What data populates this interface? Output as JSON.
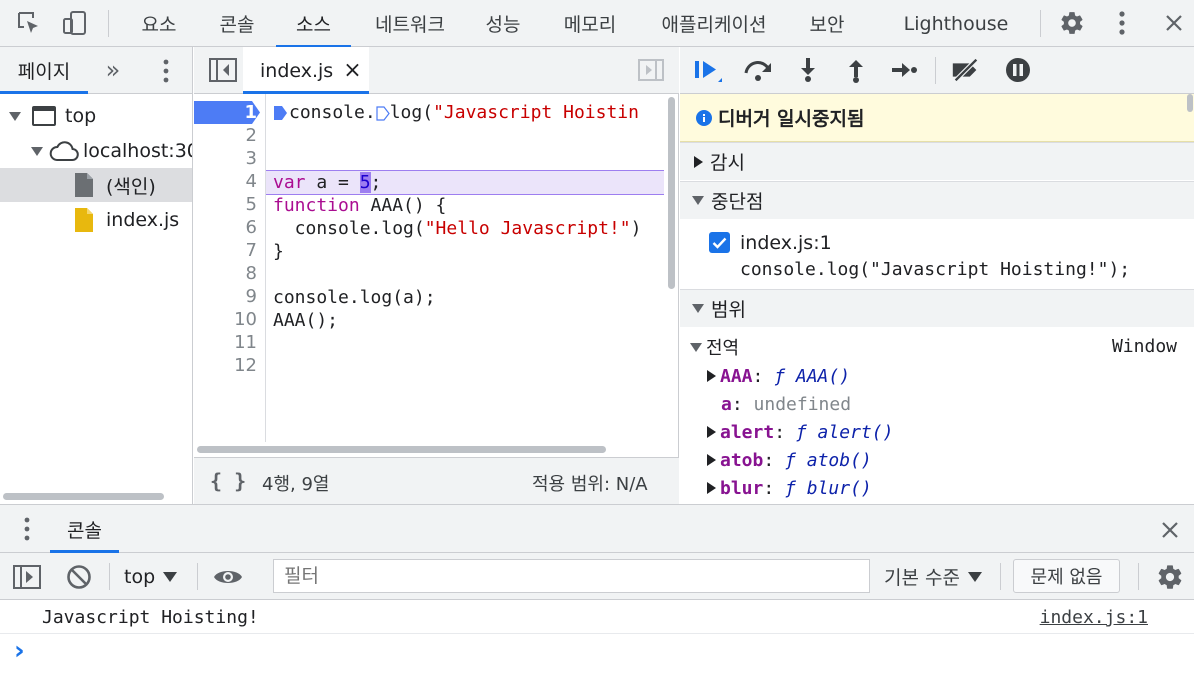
{
  "tabs": [
    "요소",
    "콘솔",
    "소스",
    "네트워크",
    "성능",
    "메모리",
    "애플리케이션",
    "보안",
    "Lighthouse"
  ],
  "active_tab": "소스",
  "navigator": {
    "tab_label": "페이지",
    "more": "»",
    "tree": {
      "top": "top",
      "host": "localhost:30",
      "index_file": "(색인)",
      "js_file": "index.js"
    }
  },
  "editor": {
    "file_tab": "index.js",
    "close_glyph": "×",
    "line_numbers": [
      "1",
      "2",
      "3",
      "4",
      "5",
      "6",
      "7",
      "8",
      "9",
      "10",
      "11",
      "12"
    ],
    "lines": {
      "l1_a": "console.",
      "l1_b": "log(",
      "l1_str": "\"Javascript Hoistin",
      "l4_kw": "var",
      "l4_mid": " a = ",
      "l4_num": "5",
      "l4_end": ";",
      "l5_kw": "function",
      "l5_rest": " AAA() {",
      "l6_a": "  console.log(",
      "l6_str": "\"Hello Javascript!\"",
      "l6_end": ")",
      "l7": "}",
      "l9": "console.log(a);",
      "l10": "AAA();"
    },
    "status": {
      "braces": "{ }",
      "position": "4행, 9열",
      "coverage": "적용 범위: N/A"
    }
  },
  "debugger": {
    "paused_banner": "디버거 일시중지됨",
    "watch_label": "감시",
    "breakpoints_label": "중단점",
    "breakpoint": {
      "location": "index.js:1",
      "code": "console.log(\"Javascript Hoisting!\");",
      "checked": true
    },
    "scope_label": "범위",
    "global_label": "전역",
    "global_value": "Window",
    "scope_items": [
      {
        "name": "AAA",
        "sep": ": ",
        "f": "ƒ",
        "value": " AAA()"
      },
      {
        "name": "a",
        "sep": ": ",
        "value": "undefined"
      },
      {
        "name": "alert",
        "sep": ": ",
        "f": "ƒ",
        "value": " alert()"
      },
      {
        "name": "atob",
        "sep": ": ",
        "f": "ƒ",
        "value": " atob()"
      },
      {
        "name": "blur",
        "sep": ": ",
        "f": "ƒ",
        "value": " blur()"
      }
    ]
  },
  "console": {
    "drawer_tab": "콘솔",
    "context": "top",
    "filter_placeholder": "필터",
    "level": "기본 수준",
    "issues": "문제 없음",
    "message": "Javascript Hoisting!",
    "source_link": "index.js:1",
    "prompt": "›"
  },
  "colors": {
    "accent": "#1a73e8",
    "toolbar_bg": "#f1f3f4",
    "paused_bg": "#fffbdd",
    "exec_line": "#4d7cf5",
    "highlight_line": "#ebe4fa"
  }
}
